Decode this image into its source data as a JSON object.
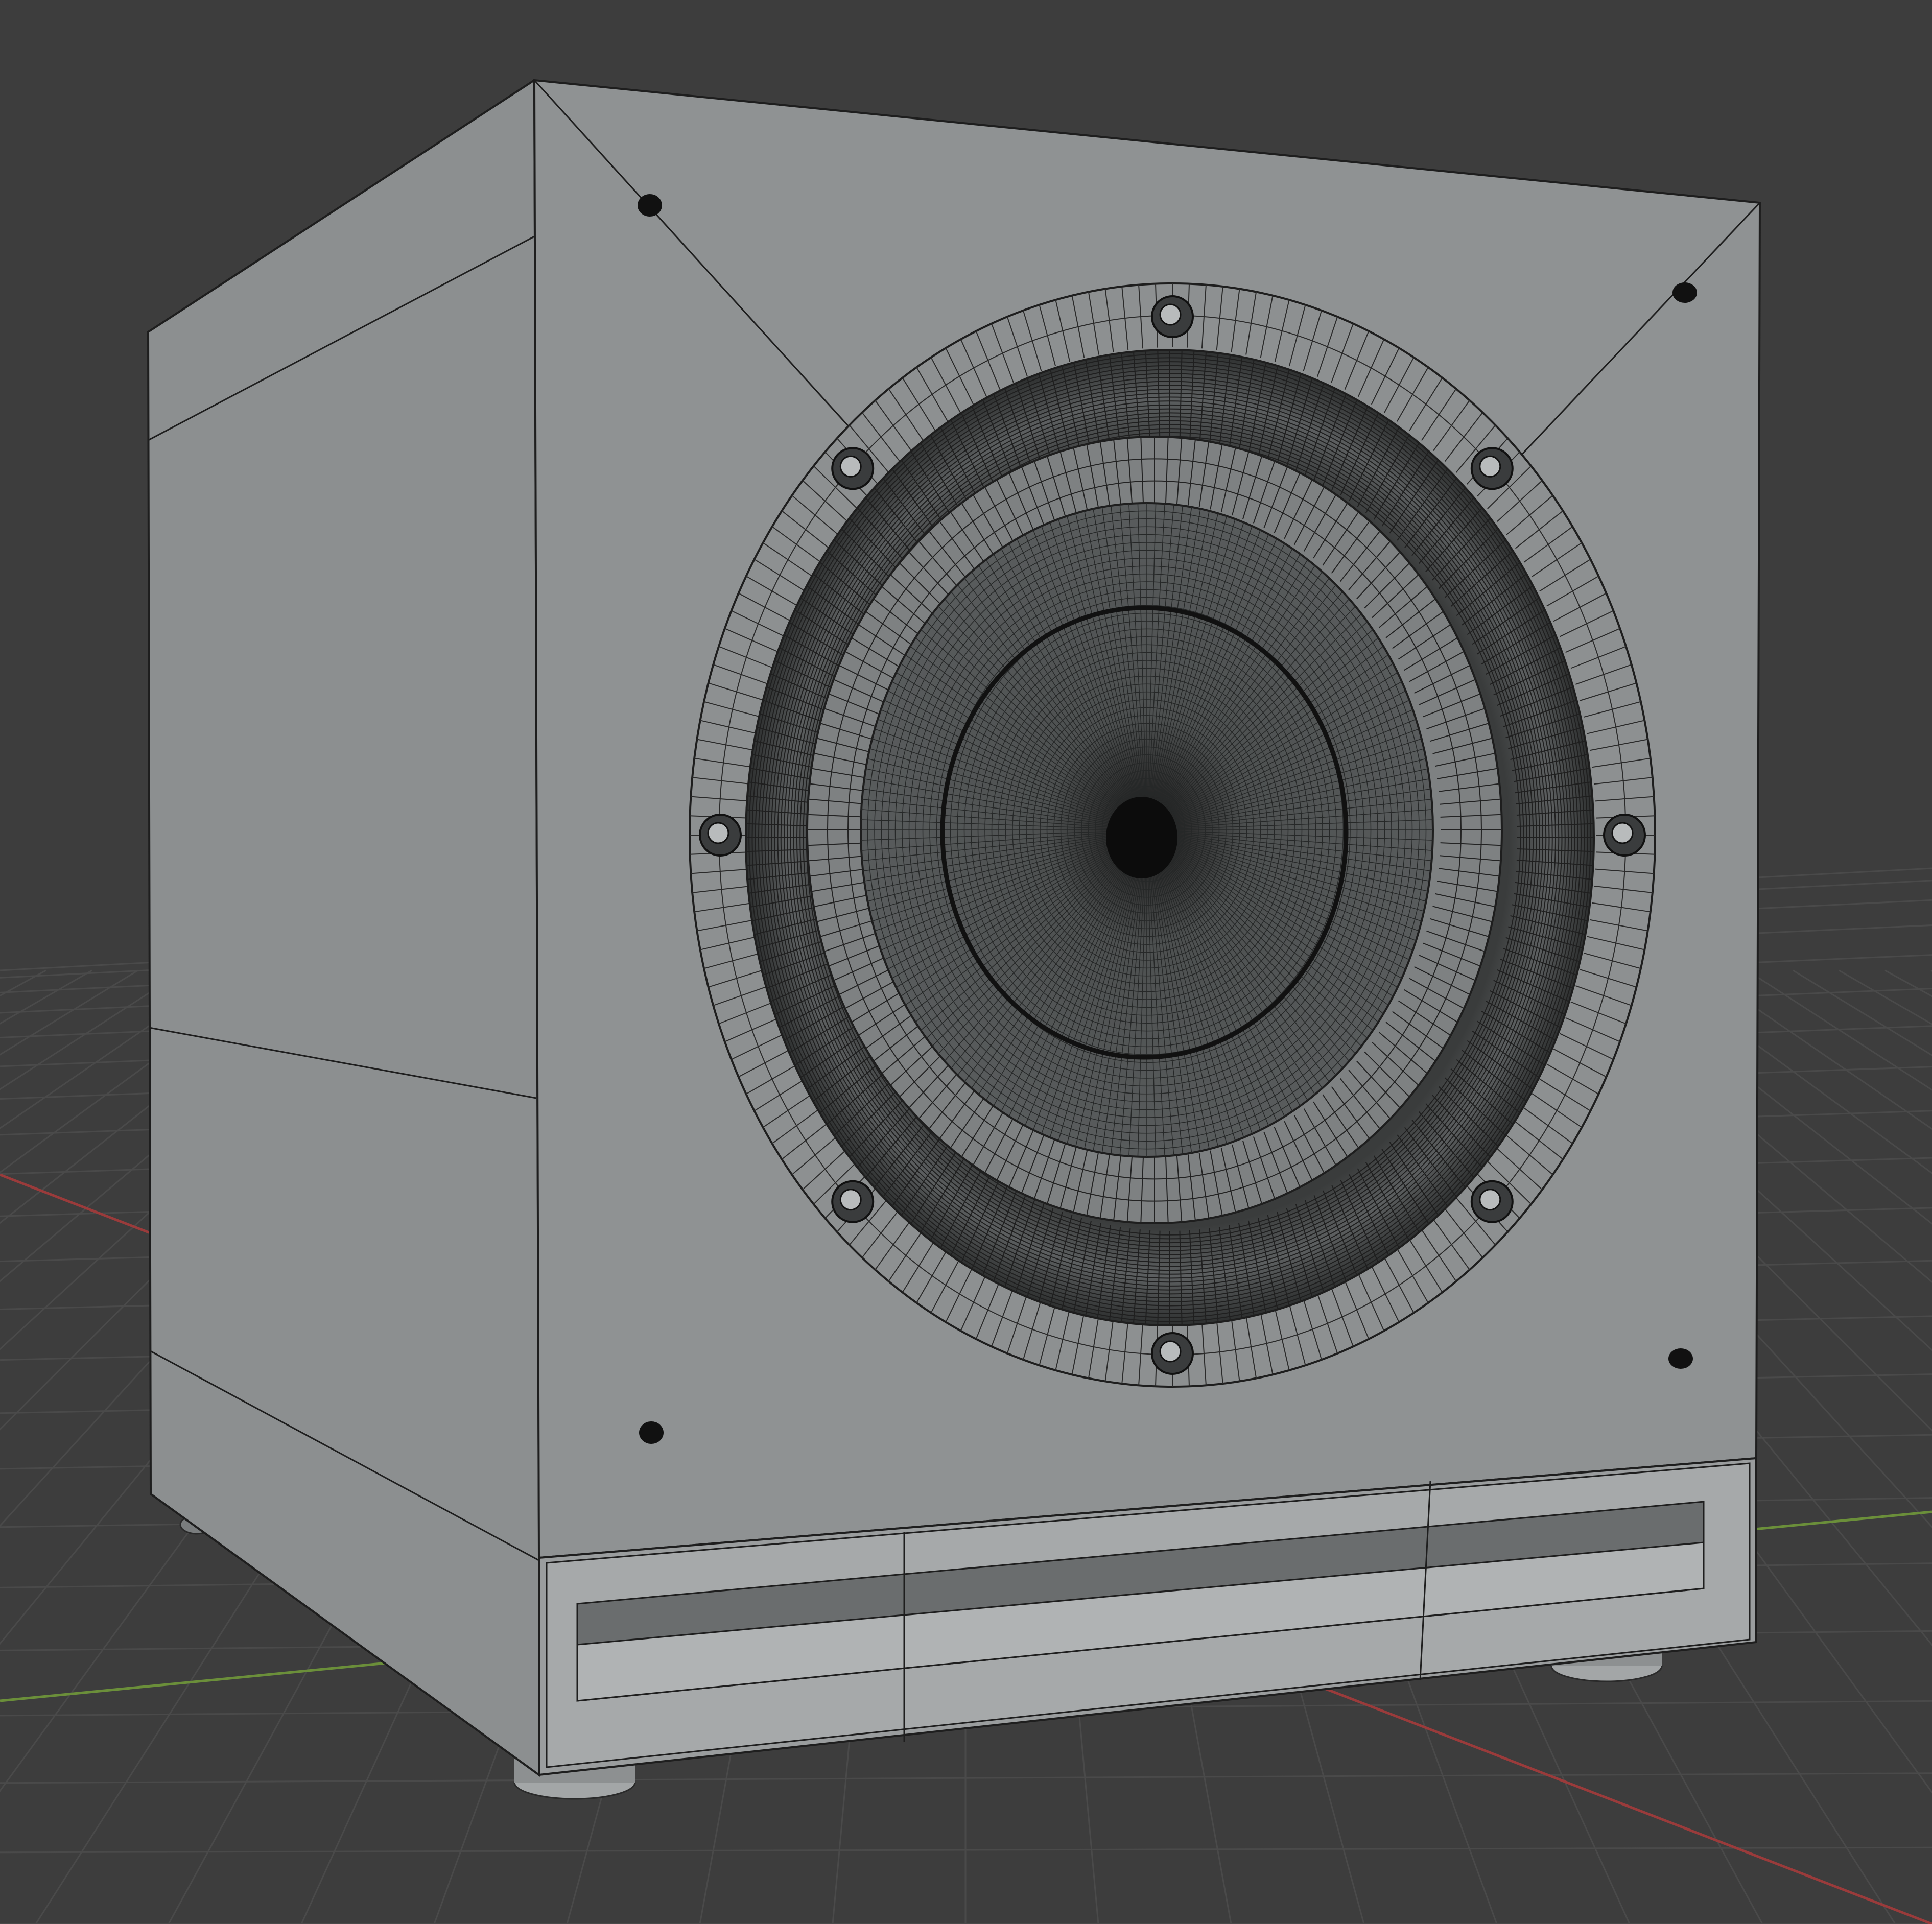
{
  "viewport": {
    "background": "#3d3d3d",
    "grid_color": "#4a4a4a",
    "axis_x_color": "#9a3b3b",
    "axis_y_color": "#6b8f3a",
    "display_mode": "solid-wireframe"
  },
  "object": {
    "name": "subwoofer-cabinet",
    "body_color": "#8a8d8e",
    "front_face_color": "#8f9293",
    "side_face_color": "#8c8f90",
    "top_face_color": "#909394",
    "edge_color": "#1e1e1e",
    "driver_screws_on_ring": 8,
    "corner_screws": 4,
    "feet": 4,
    "has_front_port": true
  }
}
